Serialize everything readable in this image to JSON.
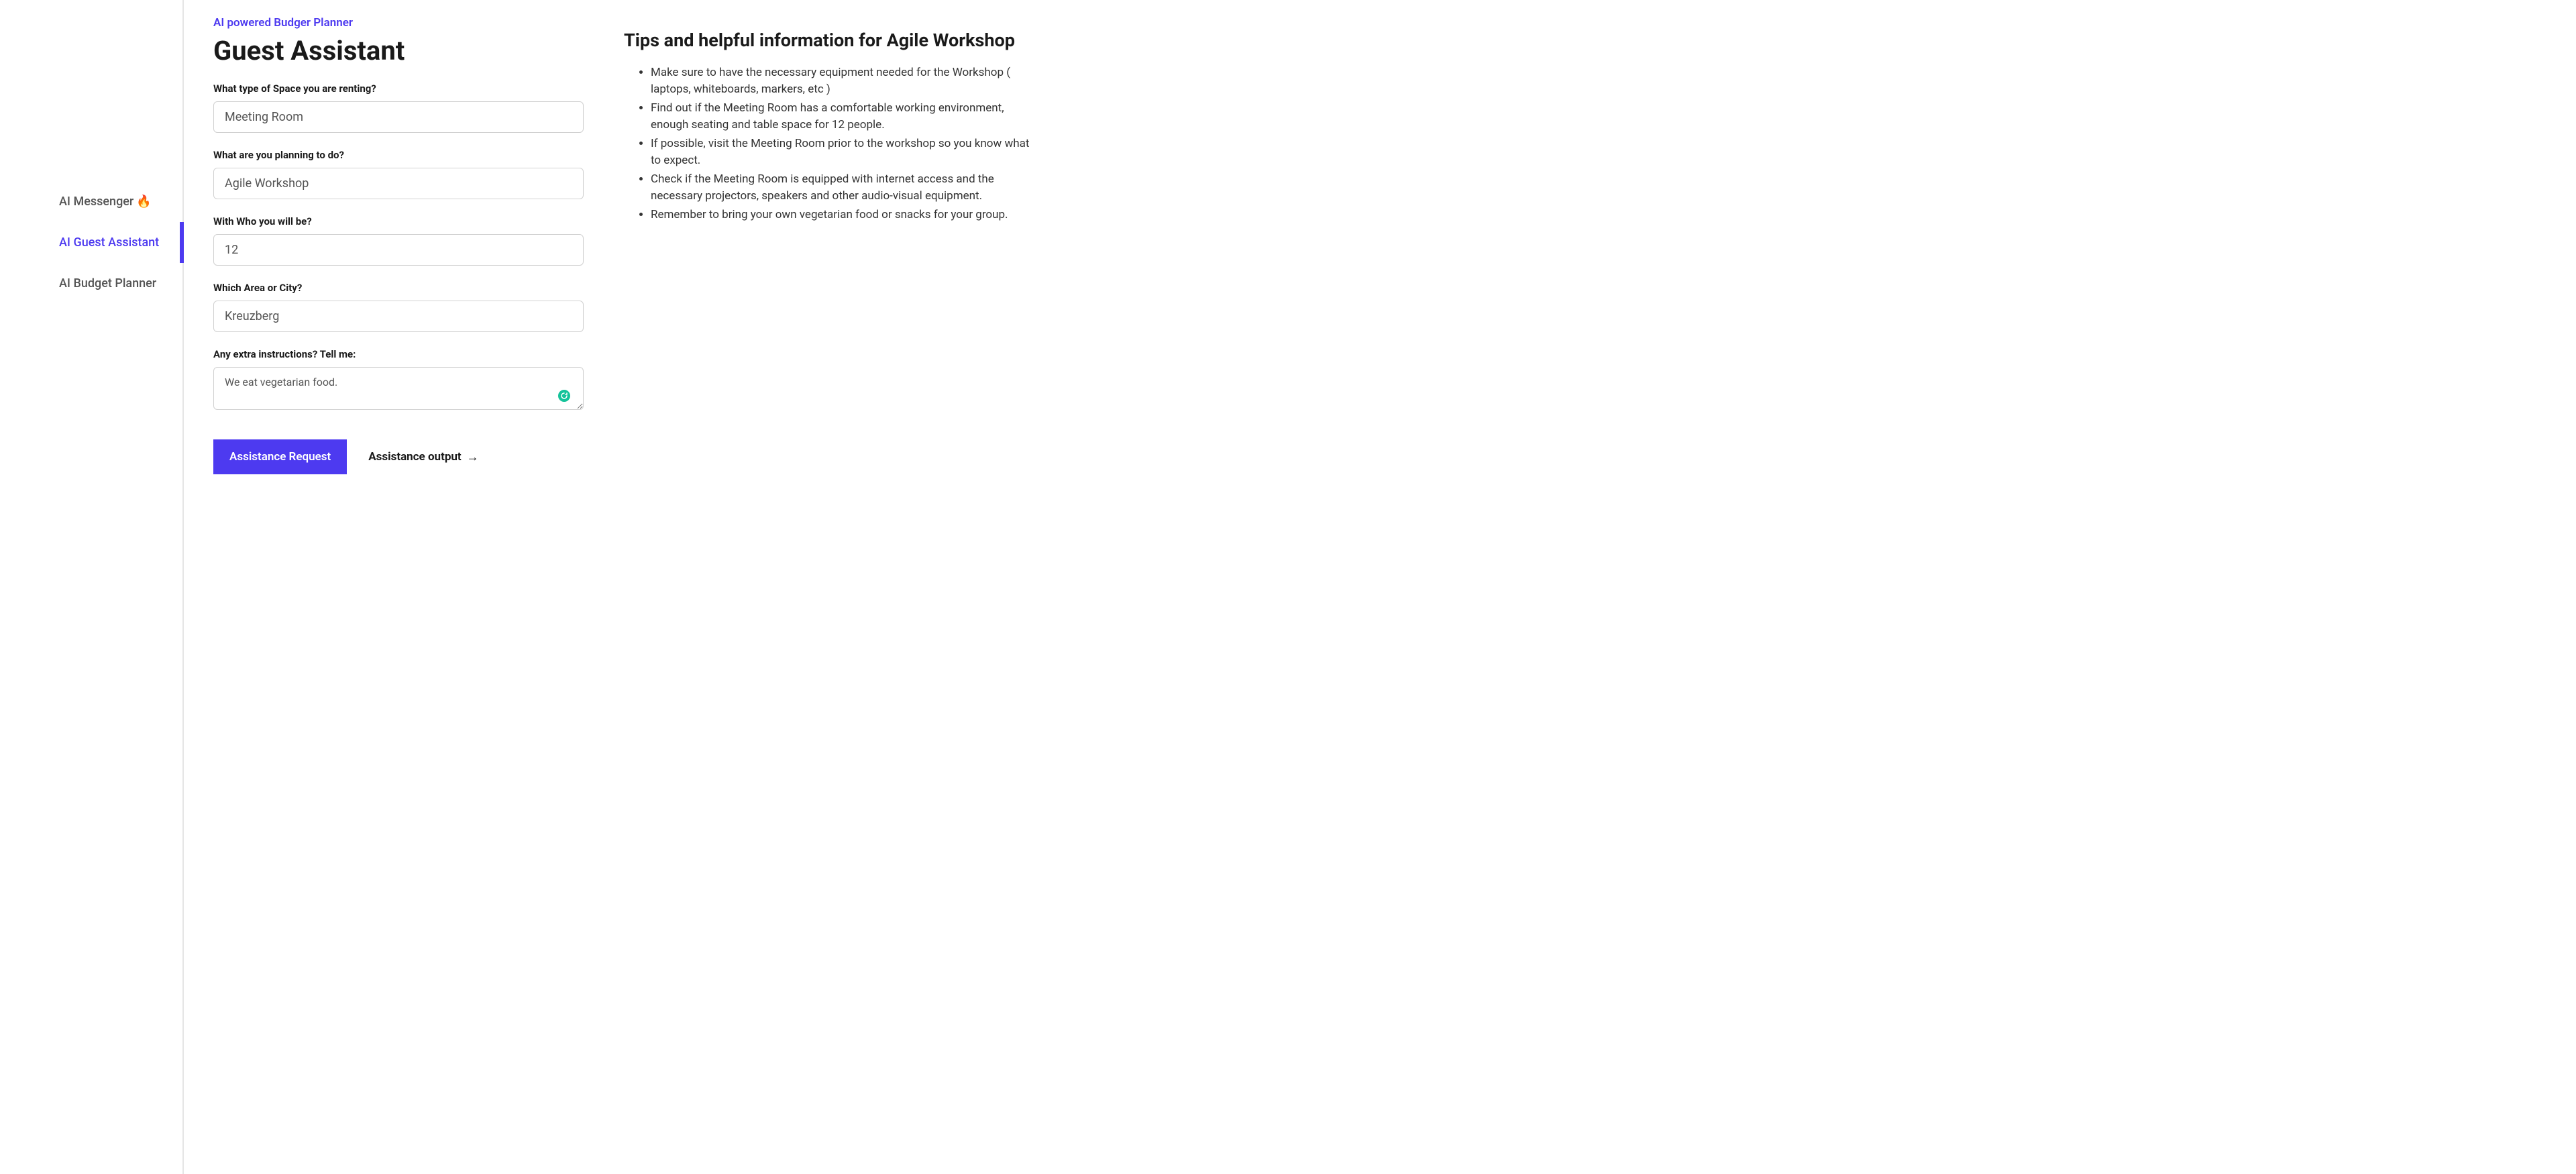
{
  "sidebar": {
    "items": [
      {
        "label": "AI Messenger",
        "icon": "🔥",
        "active": false
      },
      {
        "label": "AI Guest Assistant",
        "active": true
      },
      {
        "label": "AI Budget Planner",
        "active": false
      }
    ]
  },
  "header": {
    "kicker": "AI powered Budger Planner",
    "title": "Guest Assistant"
  },
  "form": {
    "space_label": "What type of Space you are renting?",
    "space_value": "Meeting Room",
    "activity_label": "What are you planning to do?",
    "activity_value": "Agile Workshop",
    "people_label": "With Who you will be?",
    "people_value": "12",
    "area_label": "Which Area or City?",
    "area_value": "Kreuzberg",
    "extra_label": "Any extra instructions? Tell me:",
    "extra_value": "We eat vegetarian food."
  },
  "actions": {
    "primary": "Assistance Request",
    "output": "Assistance output"
  },
  "tips": {
    "heading": "Tips and helpful information for Agile Workshop",
    "items": [
      "Make sure to have the necessary equipment needed for the Workshop ( laptops, whiteboards, markers, etc )",
      "Find out if the Meeting Room has a comfortable working environment, enough seating and table space for 12 people.",
      "If possible, visit the Meeting Room prior to the workshop so you know what to expect.",
      "Check if the Meeting Room is equipped with internet access and the necessary projectors, speakers and other audio-visual equipment.",
      "Remember to bring your own vegetarian food or snacks for your group."
    ]
  }
}
